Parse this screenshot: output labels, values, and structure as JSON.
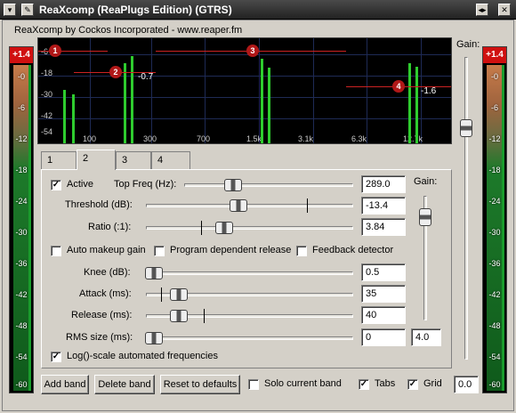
{
  "window": {
    "title": "ReaXcomp (ReaPlugs Edition) (GTRS)"
  },
  "header": {
    "credit": "ReaXcomp by Cockos Incorporated - www.reaper.fm"
  },
  "meters": {
    "left_peak": "+1.4",
    "right_peak": "+1.4",
    "scale": [
      "-0",
      "-6",
      "-12",
      "-18",
      "-24",
      "-30",
      "-36",
      "-42",
      "-48",
      "-54",
      "-60"
    ]
  },
  "gain_slider": {
    "label": "Gain:",
    "value": "0.0"
  },
  "graph": {
    "y_labels": [
      "-6",
      "-18",
      "-30",
      "-42",
      "-54"
    ],
    "x_labels": [
      "100",
      "300",
      "700",
      "1.5k",
      "3.1k",
      "6.3k",
      "12.7k"
    ],
    "bands": [
      {
        "id": "1",
        "value": ""
      },
      {
        "id": "2",
        "value": "-0.7"
      },
      {
        "id": "3",
        "value": ""
      },
      {
        "id": "4",
        "value": "-1.6"
      }
    ],
    "colors": {
      "spectrum": "#2ecc2e",
      "band": "#b01818",
      "grid": "#1e2a55"
    }
  },
  "tabs": [
    "1",
    "2",
    "3",
    "4"
  ],
  "active_tab": "2",
  "band": {
    "active_label": "Active",
    "active_checked": true,
    "top_freq_label": "Top Freq (Hz):",
    "top_freq_value": "289.0",
    "gain_label": "Gain:",
    "threshold_label": "Threshold (dB):",
    "threshold_value": "-13.4",
    "ratio_label": "Ratio (:1):",
    "ratio_value": "3.84",
    "auto_makeup_label": "Auto makeup gain",
    "program_dep_label": "Program dependent release",
    "feedback_label": "Feedback detector",
    "knee_label": "Knee (dB):",
    "knee_value": "0.5",
    "attack_label": "Attack (ms):",
    "attack_value": "35",
    "release_label": "Release (ms):",
    "release_value": "40",
    "rms_label": "RMS size (ms):",
    "rms_value": "0",
    "band_gain_value": "4.0",
    "log_scale_label": "Log()-scale automated frequencies",
    "log_scale_checked": true
  },
  "footer": {
    "add_band": "Add band",
    "delete_band": "Delete band",
    "reset": "Reset to defaults",
    "solo_label": "Solo current band",
    "tabs_label": "Tabs",
    "tabs_checked": true,
    "grid_label": "Grid",
    "grid_checked": true
  }
}
